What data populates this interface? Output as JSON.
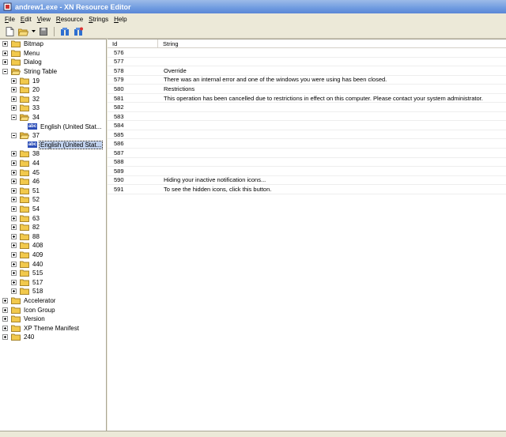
{
  "window": {
    "title": "andrew1.exe - XN Resource Editor"
  },
  "menu": [
    {
      "first": "F",
      "rest": "ile"
    },
    {
      "first": "E",
      "rest": "dit"
    },
    {
      "first": "V",
      "rest": "iew"
    },
    {
      "first": "R",
      "rest": "esource"
    },
    {
      "first": "S",
      "rest": "trings"
    },
    {
      "first": "H",
      "rest": "elp"
    }
  ],
  "toolbar": {
    "buttons": [
      "new-file-icon",
      "open-folder-icon",
      "dropdown-arrow-icon",
      "save-icon",
      "properties-icon",
      "properties-alt-icon"
    ]
  },
  "tree": [
    {
      "label": "Bitmap",
      "level": 0,
      "expander": "plus",
      "icon": "folder"
    },
    {
      "label": "Menu",
      "level": 0,
      "expander": "plus",
      "icon": "folder"
    },
    {
      "label": "Dialog",
      "level": 0,
      "expander": "plus",
      "icon": "folder"
    },
    {
      "label": "String Table",
      "level": 0,
      "expander": "minus",
      "icon": "folder-open"
    },
    {
      "label": "19",
      "level": 1,
      "expander": "plus",
      "icon": "folder"
    },
    {
      "label": "20",
      "level": 1,
      "expander": "plus",
      "icon": "folder"
    },
    {
      "label": "32",
      "level": 1,
      "expander": "plus",
      "icon": "folder"
    },
    {
      "label": "33",
      "level": 1,
      "expander": "plus",
      "icon": "folder"
    },
    {
      "label": "34",
      "level": 1,
      "expander": "minus",
      "icon": "folder-open"
    },
    {
      "label": "English (United Stat...",
      "level": 2,
      "expander": "none",
      "icon": "abc"
    },
    {
      "label": "37",
      "level": 1,
      "expander": "minus",
      "icon": "folder-open"
    },
    {
      "label": "English (United Stat...",
      "level": 2,
      "expander": "none",
      "icon": "abc",
      "selected": true
    },
    {
      "label": "38",
      "level": 1,
      "expander": "plus",
      "icon": "folder"
    },
    {
      "label": "44",
      "level": 1,
      "expander": "plus",
      "icon": "folder"
    },
    {
      "label": "45",
      "level": 1,
      "expander": "plus",
      "icon": "folder"
    },
    {
      "label": "46",
      "level": 1,
      "expander": "plus",
      "icon": "folder"
    },
    {
      "label": "51",
      "level": 1,
      "expander": "plus",
      "icon": "folder"
    },
    {
      "label": "52",
      "level": 1,
      "expander": "plus",
      "icon": "folder"
    },
    {
      "label": "54",
      "level": 1,
      "expander": "plus",
      "icon": "folder"
    },
    {
      "label": "63",
      "level": 1,
      "expander": "plus",
      "icon": "folder"
    },
    {
      "label": "82",
      "level": 1,
      "expander": "plus",
      "icon": "folder"
    },
    {
      "label": "88",
      "level": 1,
      "expander": "plus",
      "icon": "folder"
    },
    {
      "label": "408",
      "level": 1,
      "expander": "plus",
      "icon": "folder"
    },
    {
      "label": "409",
      "level": 1,
      "expander": "plus",
      "icon": "folder"
    },
    {
      "label": "440",
      "level": 1,
      "expander": "plus",
      "icon": "folder"
    },
    {
      "label": "515",
      "level": 1,
      "expander": "plus",
      "icon": "folder"
    },
    {
      "label": "517",
      "level": 1,
      "expander": "plus",
      "icon": "folder"
    },
    {
      "label": "518",
      "level": 1,
      "expander": "plus",
      "icon": "folder"
    },
    {
      "label": "Accelerator",
      "level": 0,
      "expander": "plus",
      "icon": "folder"
    },
    {
      "label": "Icon Group",
      "level": 0,
      "expander": "plus",
      "icon": "folder"
    },
    {
      "label": "Version",
      "level": 0,
      "expander": "plus",
      "icon": "folder"
    },
    {
      "label": "XP Theme Manifest",
      "level": 0,
      "expander": "plus",
      "icon": "folder"
    },
    {
      "label": "240",
      "level": 0,
      "expander": "plus",
      "icon": "folder"
    }
  ],
  "list": {
    "columns": [
      "Id",
      "String"
    ],
    "rows": [
      {
        "id": "576",
        "string": ""
      },
      {
        "id": "577",
        "string": ""
      },
      {
        "id": "578",
        "string": "Override"
      },
      {
        "id": "579",
        "string": "There was an internal error and one of the windows you were using has been closed."
      },
      {
        "id": "580",
        "string": "Restrictions"
      },
      {
        "id": "581",
        "string": "This operation has been cancelled due to restrictions in effect on this computer. Please contact your system administrator."
      },
      {
        "id": "582",
        "string": ""
      },
      {
        "id": "583",
        "string": ""
      },
      {
        "id": "584",
        "string": ""
      },
      {
        "id": "585",
        "string": ""
      },
      {
        "id": "586",
        "string": ""
      },
      {
        "id": "587",
        "string": ""
      },
      {
        "id": "588",
        "string": ""
      },
      {
        "id": "589",
        "string": ""
      },
      {
        "id": "590",
        "string": "Hiding your inactive notification icons..."
      },
      {
        "id": "591",
        "string": "To see the hidden icons, click this button."
      }
    ]
  },
  "colors": {
    "titlebar": "#6f9be0",
    "folder": "#f2c94c",
    "selection": "#c1d2ee",
    "abc": "#2d4fb8"
  }
}
